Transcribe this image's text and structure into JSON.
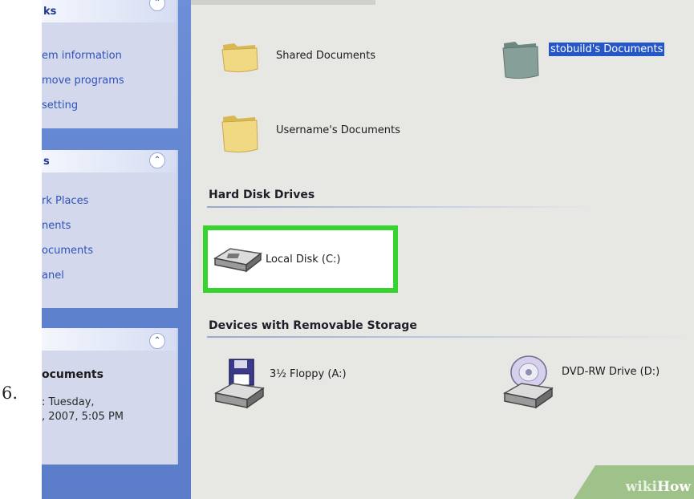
{
  "step": {
    "number": "6."
  },
  "task_pane": {
    "system_tasks": {
      "title": "ks",
      "links": [
        "em information",
        "move programs",
        "setting"
      ]
    },
    "other_places": {
      "title": "s",
      "links": [
        "rk Places",
        "nents",
        "ocuments",
        "anel"
      ]
    },
    "details": {
      "title": "ocuments",
      "text": ": Tuesday,\n, 2007, 5:05 PM"
    },
    "collapse_glyph": "⌃"
  },
  "main": {
    "folders": [
      {
        "label": "Shared Documents",
        "icon": "folder-icon",
        "color": "#e8cf71"
      },
      {
        "label": "stobuild's Documents",
        "icon": "folder-icon",
        "color": "#7f9a93",
        "selected": true
      },
      {
        "label": "Username's Documents",
        "icon": "folder-icon",
        "color": "#e8cf71"
      }
    ],
    "sections": {
      "hard_disk_drives": {
        "title": "Hard Disk Drives",
        "items": [
          {
            "label": "Local Disk (C:)",
            "icon": "hard-drive-icon"
          }
        ]
      },
      "removable_storage": {
        "title": "Devices with Removable Storage",
        "items": [
          {
            "label": "3½ Floppy (A:)",
            "icon": "floppy-drive-icon"
          },
          {
            "label": "DVD-RW Drive (D:)",
            "icon": "dvd-drive-icon"
          }
        ]
      }
    }
  },
  "watermark": {
    "prefix": "wiki",
    "suffix": "How"
  },
  "colors": {
    "highlight": "#35d42f",
    "task_pane_blue": "#6d8fd8",
    "link_blue": "#2f52b8",
    "selection": "#2456c8"
  }
}
